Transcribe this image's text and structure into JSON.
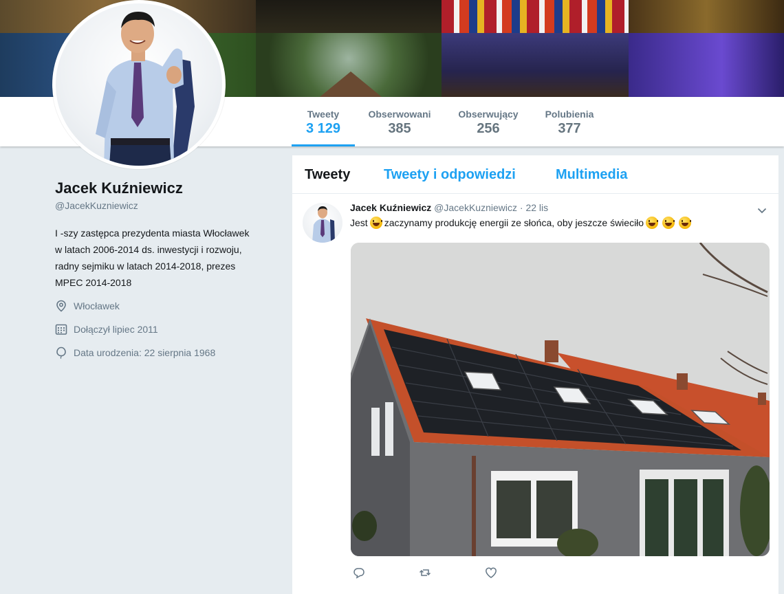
{
  "profile": {
    "name": "Jacek Kuźniewicz",
    "handle": "@JacekKuzniewicz",
    "bio": "I -szy zastępca prezydenta miasta Włocławek w latach 2006-2014 ds. inwestycji i rozwoju, radny sejmiku w latach 2014-2018, prezes MPEC 2014-2018",
    "location": "Włocławek",
    "joined": "Dołączył lipiec 2011",
    "birthday": "Data urodzenia: 22 sierpnia 1968"
  },
  "stats": [
    {
      "label": "Tweety",
      "value": "3 129",
      "active": true
    },
    {
      "label": "Obserwowani",
      "value": "385"
    },
    {
      "label": "Obserwujący",
      "value": "256"
    },
    {
      "label": "Polubienia",
      "value": "377"
    }
  ],
  "timeline": {
    "tabs": [
      "Tweety",
      "Tweety i odpowiedzi",
      "Multimedia"
    ],
    "tweet": {
      "author_name": "Jacek Kuźniewicz",
      "author_handle": "@JacekKuzniewicz",
      "separator": "·",
      "date": "22 lis",
      "text_before": "Jest",
      "text_after": "zaczynamy produkcję energii ze słońca, oby jeszcze świeciło"
    }
  },
  "colors": {
    "accent": "#1da1f2",
    "background": "#e6ecf0",
    "muted": "#657786"
  },
  "icons": [
    "location-pin-icon",
    "calendar-icon",
    "balloon-icon",
    "chevron-down-icon",
    "reply-icon",
    "retweet-icon",
    "like-icon",
    "grinning-emoji-icon"
  ]
}
